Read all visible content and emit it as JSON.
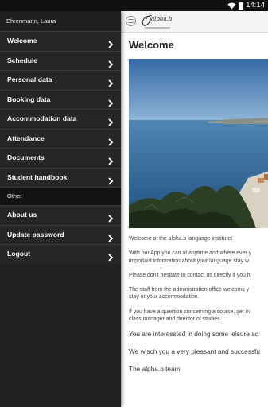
{
  "status_bar": {
    "time": "14:14"
  },
  "drawer": {
    "user_name": "Ehrenmann, Laura",
    "items": [
      {
        "label": "Welcome"
      },
      {
        "label": "Schedule"
      },
      {
        "label": "Personal data"
      },
      {
        "label": "Booking data"
      },
      {
        "label": "Accommodation data"
      },
      {
        "label": "Attendance"
      },
      {
        "label": "Documents"
      },
      {
        "label": "Student handbook"
      }
    ],
    "section_other": "Other",
    "other_items": [
      {
        "label": "About us"
      },
      {
        "label": "Update password"
      },
      {
        "label": "Logout"
      }
    ]
  },
  "appbar": {
    "logo_text": "alpha.b"
  },
  "main": {
    "title": "Welcome",
    "paragraphs": [
      "Welcome at the alpha.b language institute!",
      "With our App you can at anytime and where ever y",
      "important information about your language stay w",
      "Please don't hesitate to contact us directly if you h",
      "The staff from the administration office welcoms y",
      "stay or your accommodation.",
      "If you have a question concerning a course, get in",
      "class manager and director of studies.",
      "You are interessted in doing some leisure ac",
      "We wisch you a very pleasant and successfu",
      "The alpha.b team"
    ]
  },
  "colors": {
    "drawer_bg": "#262626",
    "drawer_section_bg": "#141414",
    "appbar_bg": "#f4f4f4",
    "text": "#444444"
  }
}
